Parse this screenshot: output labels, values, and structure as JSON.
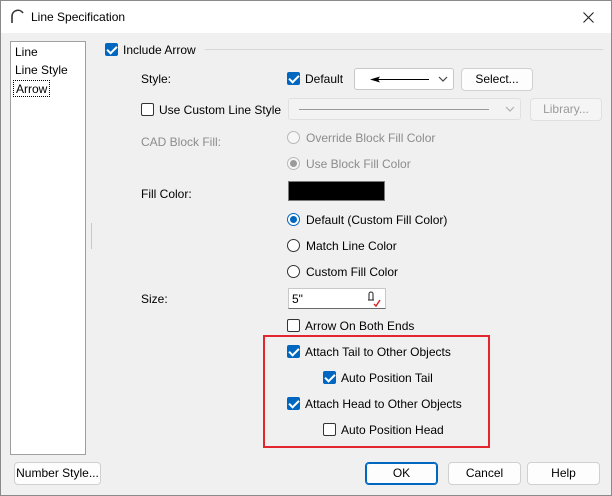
{
  "window": {
    "title": "Line Specification"
  },
  "nav": {
    "items": [
      "Line",
      "Line Style",
      "Arrow"
    ],
    "selected_index": 2
  },
  "include_arrow": {
    "label": "Include Arrow",
    "checked": true
  },
  "style": {
    "label": "Style:",
    "default_label": "Default",
    "default_checked": true,
    "select_button": "Select..."
  },
  "custom_line_style": {
    "label": "Use Custom Line Style",
    "checked": false,
    "library_button": "Library..."
  },
  "cad_block_fill": {
    "label": "CAD Block Fill:",
    "override_label": "Override Block Fill Color",
    "use_label": "Use Block Fill Color",
    "selected": "use"
  },
  "fill_color": {
    "label": "Fill Color:",
    "swatch_color": "#000000",
    "options": [
      "Default (Custom Fill Color)",
      "Match Line Color",
      "Custom Fill Color"
    ],
    "selected_index": 0
  },
  "size": {
    "label": "Size:",
    "value": "5\""
  },
  "arrow_both_ends": {
    "label": "Arrow On Both Ends",
    "checked": false
  },
  "attach_tail": {
    "label": "Attach Tail to Other Objects",
    "checked": true
  },
  "auto_tail": {
    "label": "Auto Position Tail",
    "checked": true
  },
  "attach_head": {
    "label": "Attach Head to Other Objects",
    "checked": true
  },
  "auto_head": {
    "label": "Auto Position Head",
    "checked": false
  },
  "footer": {
    "number_style": "Number Style...",
    "ok": "OK",
    "cancel": "Cancel",
    "help": "Help"
  },
  "colors": {
    "accent": "#0067c0",
    "highlight": "#e3262e"
  }
}
